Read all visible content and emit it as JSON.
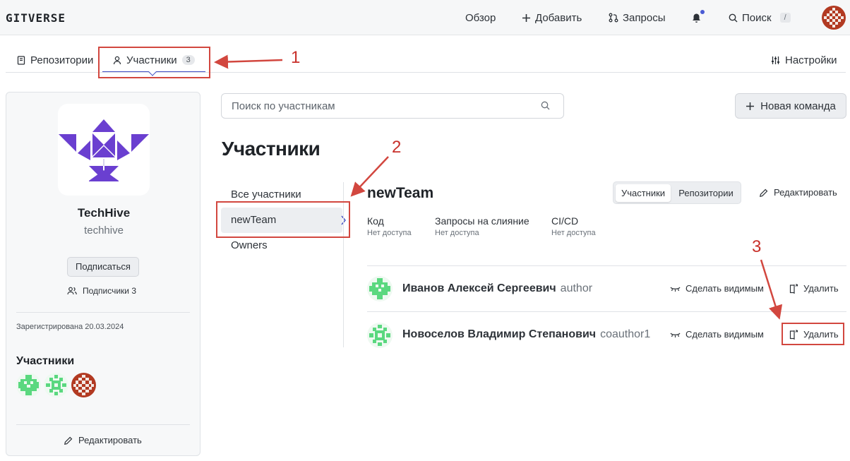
{
  "header": {
    "logo": "GITVERSE",
    "nav": {
      "overview": "Обзор",
      "add": "Добавить",
      "requests": "Запросы",
      "search": "Поиск",
      "search_shortcut": "/"
    }
  },
  "tabs": {
    "repositories": "Репозитории",
    "members": "Участники",
    "members_count": "3",
    "settings": "Настройки"
  },
  "org": {
    "name": "TechHive",
    "handle": "techhive",
    "subscribe_label": "Подписаться",
    "subscribers_label": "Подписчики 3",
    "registered": "Зарегистрирована 20.03.2024",
    "members_heading": "Участники",
    "edit_label": "Редактировать"
  },
  "main": {
    "search_placeholder": "Поиск по участникам",
    "new_team_label": "Новая команда",
    "title": "Участники",
    "teams": [
      "Все участники",
      "newTeam",
      "Owners"
    ]
  },
  "team": {
    "name": "newTeam",
    "seg_members": "Участники",
    "seg_repos": "Репозитории",
    "edit_label": "Редактировать",
    "permissions": [
      {
        "label": "Код",
        "value": "Нет доступа"
      },
      {
        "label": "Запросы на слияние",
        "value": "Нет доступа"
      },
      {
        "label": "CI/CD",
        "value": "Нет доступа"
      }
    ],
    "members": [
      {
        "name": "Иванов Алексей Сергеевич",
        "role": "author",
        "make_visible": "Сделать видимым",
        "remove": "Удалить"
      },
      {
        "name": "Новоселов Владимир Степанович",
        "role": "coauthor1",
        "make_visible": "Сделать видимым",
        "remove": "Удалить"
      }
    ]
  },
  "annotations": {
    "n1": "1",
    "n2": "2",
    "n3": "3",
    "color": "#d2473f"
  },
  "colors": {
    "accent": "#3f4dc2",
    "logo_purple": "#6a3fd0",
    "avatar_green": "#5ad87f",
    "avatar_red": "#b23a22"
  }
}
